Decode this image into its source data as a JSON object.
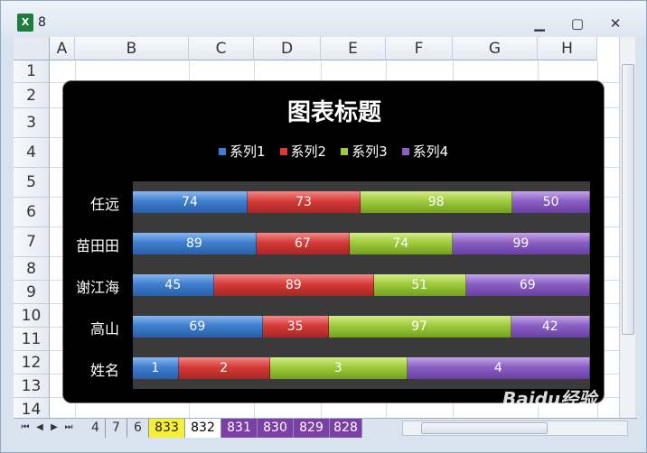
{
  "window": {
    "title": "8",
    "app_icon": "excel-icon"
  },
  "columns": [
    "A",
    "B",
    "C",
    "D",
    "E",
    "F",
    "G",
    "H"
  ],
  "rows": [
    "1",
    "2",
    "3",
    "4",
    "5",
    "6",
    "7",
    "8",
    "9",
    "10",
    "11",
    "12",
    "13",
    "14"
  ],
  "chart_data": {
    "type": "bar",
    "orientation": "horizontal-stacked",
    "title": "图表标题",
    "categories": [
      "姓名",
      "高山",
      "谢江海",
      "苗田田",
      "任远"
    ],
    "series": [
      {
        "name": "系列1",
        "values": [
          1,
          69,
          45,
          89,
          74
        ]
      },
      {
        "name": "系列2",
        "values": [
          2,
          35,
          89,
          67,
          73
        ]
      },
      {
        "name": "系列3",
        "values": [
          3,
          97,
          51,
          74,
          98
        ]
      },
      {
        "name": "系列4",
        "values": [
          4,
          42,
          69,
          99,
          50
        ]
      }
    ],
    "legend": "top",
    "data_labels": true,
    "colors": {
      "s1": "#3f7fcf",
      "s2": "#d63b38",
      "s3": "#9fcb3d",
      "s4": "#8a5fc4",
      "background": "#000000",
      "plot_area": "#3a3a3a"
    }
  },
  "sheet_tabs": [
    {
      "label": "4",
      "style": "normal"
    },
    {
      "label": "7",
      "style": "normal"
    },
    {
      "label": "6",
      "style": "normal"
    },
    {
      "label": "833",
      "style": "yellow"
    },
    {
      "label": "832",
      "style": "active"
    },
    {
      "label": "831",
      "style": "purple"
    },
    {
      "label": "830",
      "style": "purple"
    },
    {
      "label": "829",
      "style": "purple"
    },
    {
      "label": "828",
      "style": "purple"
    }
  ],
  "watermark": "Bai du 经验"
}
